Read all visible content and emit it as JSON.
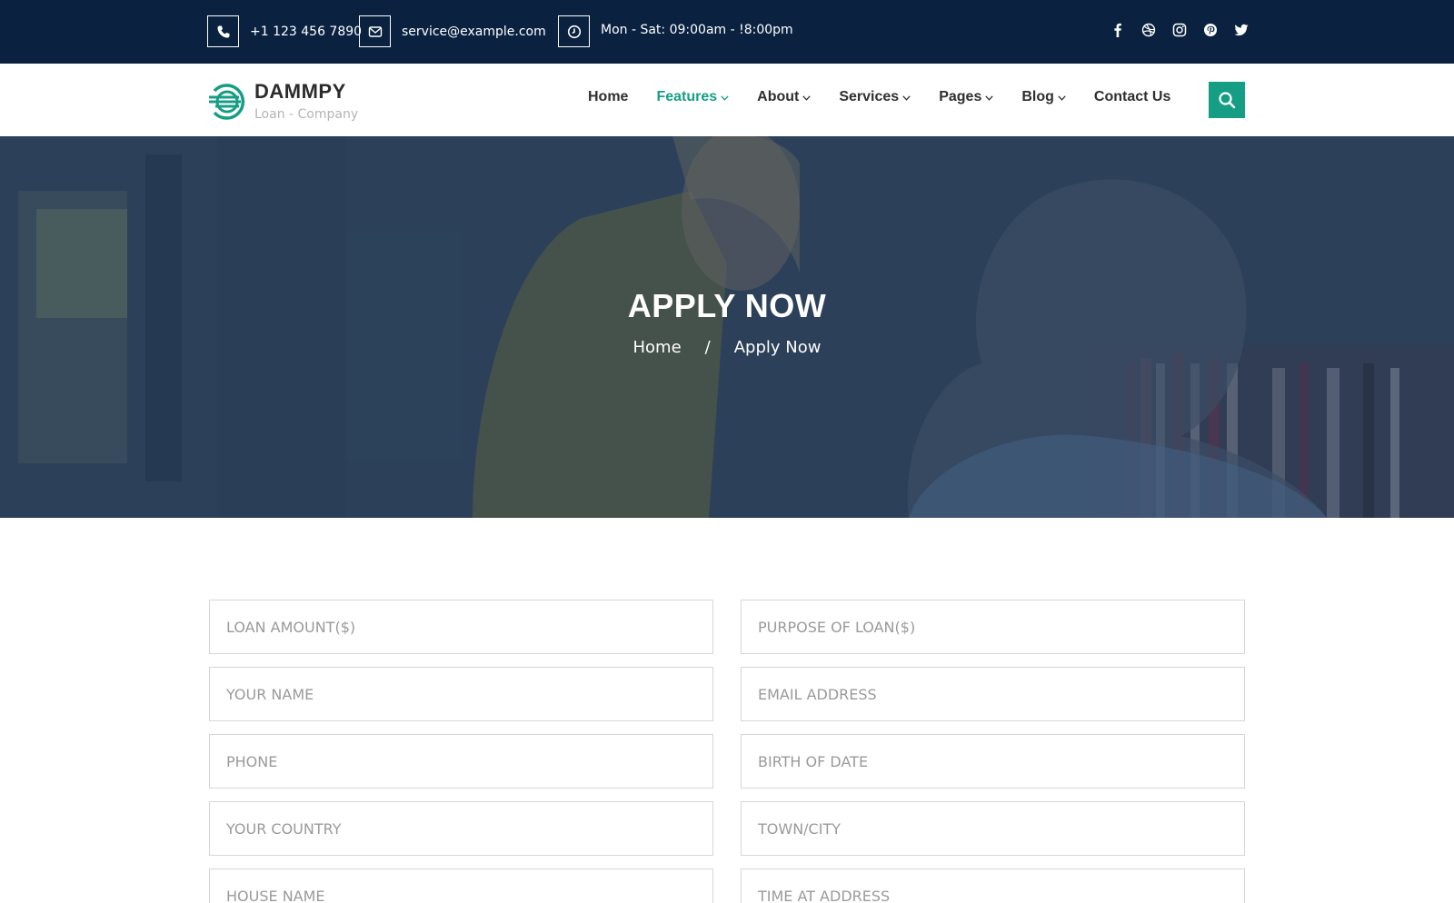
{
  "topbar": {
    "phone": "+1 123 456 7890",
    "email": "service@example.com",
    "hours": "Mon - Sat: 09:00am - !8:00pm",
    "socials": [
      "facebook-icon",
      "dribbble-icon",
      "instagram-icon",
      "pinterest-icon",
      "twitter-icon"
    ]
  },
  "brand": {
    "name": "DAMMPY",
    "tagline": "Loan - Company",
    "accent": "#169e84",
    "dark": "#0a2240"
  },
  "nav": {
    "items": [
      {
        "label": "Home",
        "dropdown": false,
        "active": false
      },
      {
        "label": "Features",
        "dropdown": true,
        "active": true
      },
      {
        "label": "About",
        "dropdown": true,
        "active": false
      },
      {
        "label": "Services",
        "dropdown": true,
        "active": false
      },
      {
        "label": "Pages",
        "dropdown": true,
        "active": false
      },
      {
        "label": "Blog",
        "dropdown": true,
        "active": false
      },
      {
        "label": "Contact Us",
        "dropdown": false,
        "active": false
      }
    ]
  },
  "hero": {
    "title": "APPLY NOW",
    "breadcrumb": [
      "Home",
      "/",
      "Apply Now"
    ]
  },
  "form": {
    "fields": [
      {
        "placeholder": "LOAN AMOUNT($)",
        "value": ""
      },
      {
        "placeholder": "PURPOSE OF LOAN($)",
        "value": ""
      },
      {
        "placeholder": "YOUR NAME",
        "value": ""
      },
      {
        "placeholder": "EMAIL ADDRESS",
        "value": ""
      },
      {
        "placeholder": "PHONE",
        "value": ""
      },
      {
        "placeholder": "BIRTH OF DATE",
        "value": ""
      },
      {
        "placeholder": "YOUR COUNTRY",
        "value": ""
      },
      {
        "placeholder": "TOWN/CITY",
        "value": ""
      },
      {
        "placeholder": "HOUSE NAME",
        "value": ""
      },
      {
        "placeholder": "TIME AT ADDRESS",
        "value": ""
      }
    ]
  }
}
